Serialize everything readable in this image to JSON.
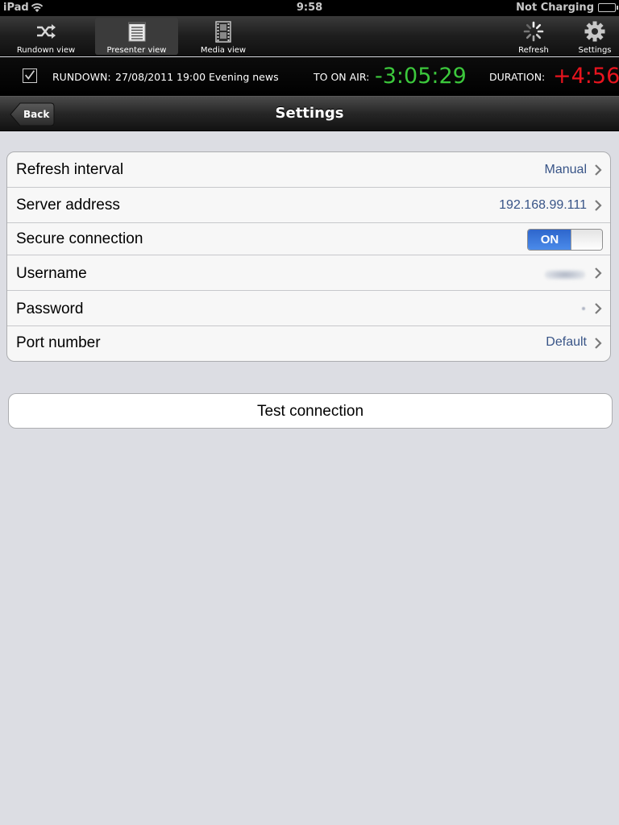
{
  "status_bar": {
    "device": "iPad",
    "time": "9:58",
    "charging": "Not Charging",
    "icons": [
      "wifi-icon",
      "battery-icon"
    ]
  },
  "toolbar": {
    "items": [
      {
        "label": "Rundown view",
        "icon": "shuffle-icon"
      },
      {
        "label": "Presenter view",
        "icon": "notepad-icon",
        "active": true
      },
      {
        "label": "Media view",
        "icon": "film-icon"
      },
      {
        "label": "Refresh",
        "icon": "spinner-icon"
      },
      {
        "label": "Settings",
        "icon": "gear-icon"
      }
    ]
  },
  "rundown_bar": {
    "rundown_label": "RUNDOWN:",
    "rundown_value": "27/08/2011  19:00 Evening news",
    "on_air_label": "TO ON AIR:",
    "on_air_value": "-3:05:29",
    "duration_label": "DURATION:",
    "duration_value": "+4:56",
    "colors": {
      "on_air": "#3cc83c",
      "duration": "#e8141e"
    }
  },
  "nav": {
    "back_label": "Back",
    "title": "Settings"
  },
  "settings": {
    "rows": [
      {
        "label": "Refresh interval",
        "value": "Manual"
      },
      {
        "label": "Server address",
        "value": "192.168.99.111"
      },
      {
        "label": "Secure connection",
        "toggle": "ON",
        "toggle_state": true
      },
      {
        "label": "Username",
        "value_obscured": true
      },
      {
        "label": "Password",
        "value_obscured": true
      },
      {
        "label": "Port number",
        "value": "Default"
      }
    ],
    "test_button": "Test connection"
  }
}
